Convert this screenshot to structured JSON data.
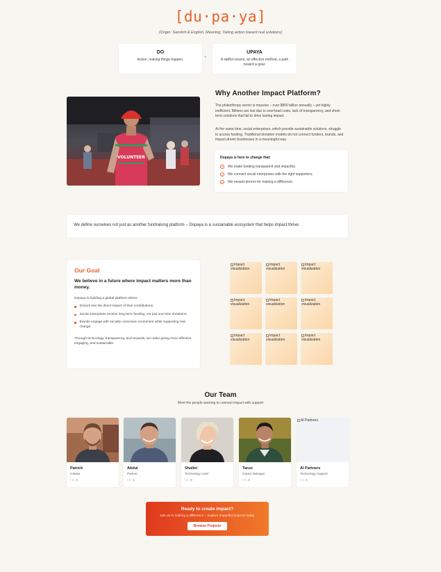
{
  "hero": {
    "logo": "[du·pa·ya]",
    "origin": "(Origin: Sanskrit & English, Meaning: Taking action toward real solutions)",
    "plus": "+",
    "cards": [
      {
        "title": "DO",
        "desc": "Action, making things happen."
      },
      {
        "title": "UPAYA",
        "desc": "A skillful means, an effective method, a path toward a goal."
      }
    ]
  },
  "why": {
    "title": "Why Another Impact Platform?",
    "p1": "The philanthropy sector is massive – over $800 billion annually – yet highly inefficient. Billions are lost due to overhead costs, lack of transparency, and short-term solutions that fail to drive lasting impact.",
    "p2": "At the same time, social enterprises, which provide sustainable solutions, struggle to access funding. Traditional donation models do not connect funders, brands, and impact-driven businesses in a meaningful way.",
    "box_title": "Dopaya is here to change that:",
    "items": [
      "We make funding transparent and impactful.",
      "We connect social enterprises with the right supporters.",
      "We reward donors for making a difference."
    ],
    "photo_text": "VOLUNTEER"
  },
  "banner": "We define ourselves not just as another fundraising platform – Dopaya is a sustainable ecosystem that helps impact thrive.",
  "goal": {
    "title": "Our Goal",
    "subtitle": "We believe in a future where impact matters more than money.",
    "intro": "Dopaya is building a global platform where:",
    "items": [
      "Donors see the direct impact of their contributions.",
      "Social enterprises receive long-term funding, not just one-time donations.",
      "Brands engage with socially conscious consumers while supporting real change."
    ],
    "outro": "Through technology, transparency, and rewards, we make giving more effective, engaging, and sustainable.",
    "tile_alt": "Impact visualization"
  },
  "team": {
    "title": "Our Team",
    "subtitle": "Meet the people working to connect impact with support",
    "members": [
      {
        "name": "Patrick",
        "role": "Initiator"
      },
      {
        "name": "Abdul",
        "role": "Partner"
      },
      {
        "name": "Shalini",
        "role": "Technology Lead"
      },
      {
        "name": "Tarun",
        "role": "Impact Manager"
      },
      {
        "name": "AI Partners",
        "role": "Technology Support",
        "alt": "AI Partners"
      }
    ]
  },
  "cta": {
    "title": "Ready to create impact?",
    "subtitle": "Join us in making a difference – explore impactful projects today.",
    "button": "Browse Projects"
  },
  "colors": {
    "accent": "#e8602a",
    "cta_start": "#e0391e",
    "cta_end": "#f07a2a",
    "background": "#f7f6f1"
  }
}
